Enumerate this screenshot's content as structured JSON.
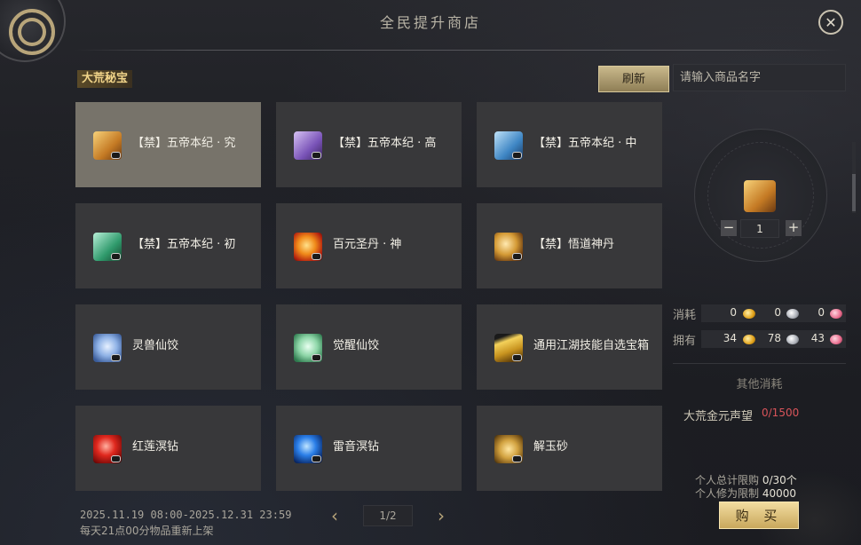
{
  "title": "全民提升商店",
  "close_icon": "close-icon",
  "category": "大荒秘宝",
  "refresh_label": "刷新",
  "search": {
    "placeholder": "请输入商品名字",
    "value": ""
  },
  "items": [
    {
      "name": "【禁】五帝本纪 · 究",
      "icon": "book-orange-icon",
      "selected": true
    },
    {
      "name": "【禁】五帝本纪 · 高",
      "icon": "book-purple-icon",
      "selected": false
    },
    {
      "name": "【禁】五帝本纪 · 中",
      "icon": "book-blue-icon",
      "selected": false
    },
    {
      "name": "【禁】五帝本纪 · 初",
      "icon": "book-green-icon",
      "selected": false
    },
    {
      "name": "百元圣丹 · 神",
      "icon": "pill-red-icon",
      "selected": false
    },
    {
      "name": "【禁】悟道神丹",
      "icon": "orb-gold-icon",
      "selected": false
    },
    {
      "name": "灵兽仙饺",
      "icon": "dumpling-blue-icon",
      "selected": false
    },
    {
      "name": "觉醒仙饺",
      "icon": "dumpling-green-icon",
      "selected": false
    },
    {
      "name": "通用江湖技能自选宝箱",
      "icon": "chest-gold-icon",
      "selected": false
    },
    {
      "name": "红莲溟钻",
      "icon": "drill-red-icon",
      "selected": false
    },
    {
      "name": "雷音溟钻",
      "icon": "drill-blue-icon",
      "selected": false
    },
    {
      "name": "解玉砂",
      "icon": "sand-gold-icon",
      "selected": false
    }
  ],
  "footer": {
    "date_range": "2025.11.19 08:00-2025.12.31 23:59",
    "refresh_note": "每天21点00分物品重新上架"
  },
  "pager": {
    "current": "1/2"
  },
  "preview": {
    "icon": "book-orange-icon",
    "quantity": "1"
  },
  "cost": {
    "label": "消耗",
    "values": [
      "0",
      "0",
      "0"
    ]
  },
  "own": {
    "label": "拥有",
    "values": [
      "34",
      "78",
      "43"
    ]
  },
  "currency_icons": [
    "gold-coin-icon",
    "silver-coin-icon",
    "pink-coin-icon"
  ],
  "other_cost": {
    "title": "其他消耗",
    "req_label": "大荒金元声望",
    "req_value": "0/1500"
  },
  "limits": {
    "total_label": "个人总计限购",
    "total_value": "0/30个",
    "cultivation_label": "个人修为限制",
    "cultivation_value": "40000"
  },
  "buy_label": "购 买",
  "colors": {
    "accent_gold": "#c9a85c",
    "warning_red": "#d9545a"
  }
}
